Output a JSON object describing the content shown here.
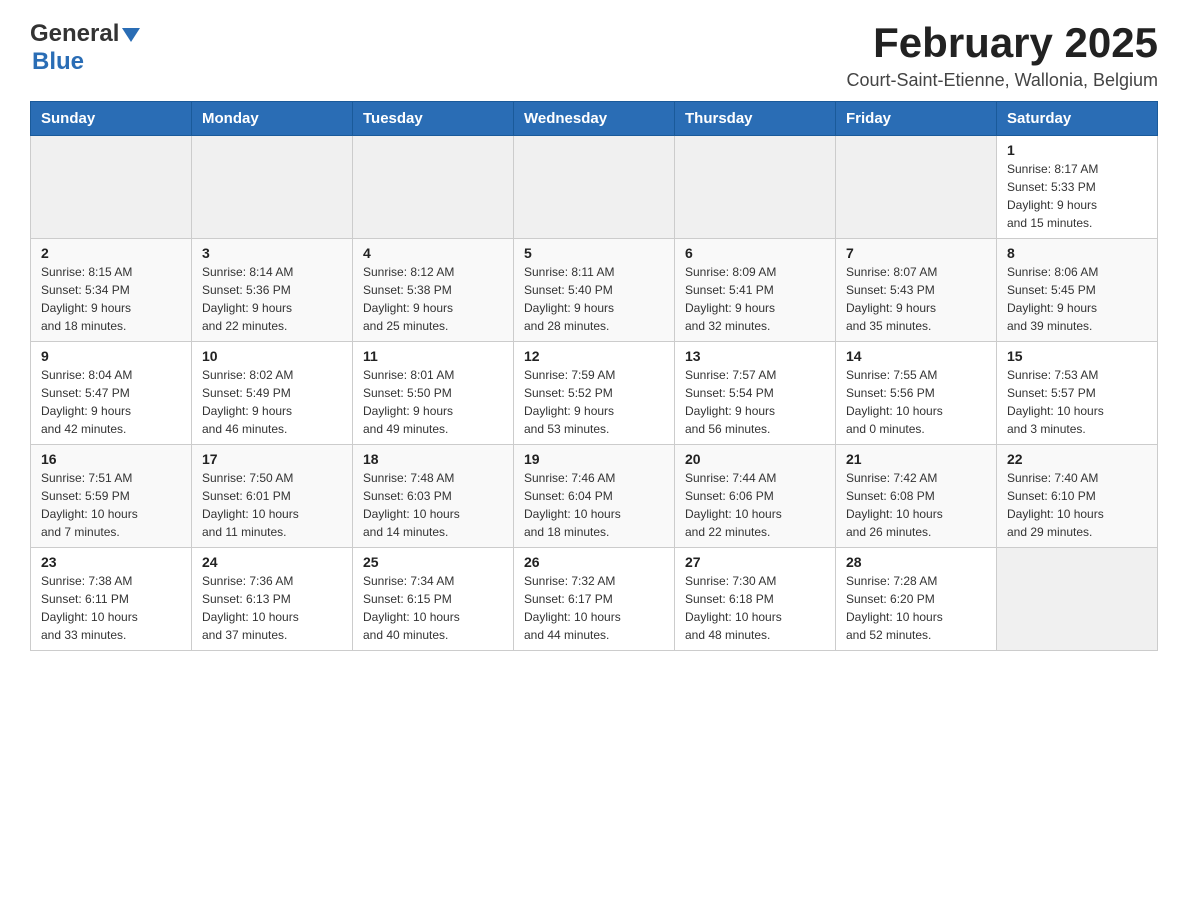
{
  "header": {
    "logo": {
      "general": "General",
      "blue": "Blue"
    },
    "title": "February 2025",
    "location": "Court-Saint-Etienne, Wallonia, Belgium"
  },
  "days_of_week": [
    "Sunday",
    "Monday",
    "Tuesday",
    "Wednesday",
    "Thursday",
    "Friday",
    "Saturday"
  ],
  "weeks": [
    [
      {
        "day": "",
        "info": ""
      },
      {
        "day": "",
        "info": ""
      },
      {
        "day": "",
        "info": ""
      },
      {
        "day": "",
        "info": ""
      },
      {
        "day": "",
        "info": ""
      },
      {
        "day": "",
        "info": ""
      },
      {
        "day": "1",
        "info": "Sunrise: 8:17 AM\nSunset: 5:33 PM\nDaylight: 9 hours\nand 15 minutes."
      }
    ],
    [
      {
        "day": "2",
        "info": "Sunrise: 8:15 AM\nSunset: 5:34 PM\nDaylight: 9 hours\nand 18 minutes."
      },
      {
        "day": "3",
        "info": "Sunrise: 8:14 AM\nSunset: 5:36 PM\nDaylight: 9 hours\nand 22 minutes."
      },
      {
        "day": "4",
        "info": "Sunrise: 8:12 AM\nSunset: 5:38 PM\nDaylight: 9 hours\nand 25 minutes."
      },
      {
        "day": "5",
        "info": "Sunrise: 8:11 AM\nSunset: 5:40 PM\nDaylight: 9 hours\nand 28 minutes."
      },
      {
        "day": "6",
        "info": "Sunrise: 8:09 AM\nSunset: 5:41 PM\nDaylight: 9 hours\nand 32 minutes."
      },
      {
        "day": "7",
        "info": "Sunrise: 8:07 AM\nSunset: 5:43 PM\nDaylight: 9 hours\nand 35 minutes."
      },
      {
        "day": "8",
        "info": "Sunrise: 8:06 AM\nSunset: 5:45 PM\nDaylight: 9 hours\nand 39 minutes."
      }
    ],
    [
      {
        "day": "9",
        "info": "Sunrise: 8:04 AM\nSunset: 5:47 PM\nDaylight: 9 hours\nand 42 minutes."
      },
      {
        "day": "10",
        "info": "Sunrise: 8:02 AM\nSunset: 5:49 PM\nDaylight: 9 hours\nand 46 minutes."
      },
      {
        "day": "11",
        "info": "Sunrise: 8:01 AM\nSunset: 5:50 PM\nDaylight: 9 hours\nand 49 minutes."
      },
      {
        "day": "12",
        "info": "Sunrise: 7:59 AM\nSunset: 5:52 PM\nDaylight: 9 hours\nand 53 minutes."
      },
      {
        "day": "13",
        "info": "Sunrise: 7:57 AM\nSunset: 5:54 PM\nDaylight: 9 hours\nand 56 minutes."
      },
      {
        "day": "14",
        "info": "Sunrise: 7:55 AM\nSunset: 5:56 PM\nDaylight: 10 hours\nand 0 minutes."
      },
      {
        "day": "15",
        "info": "Sunrise: 7:53 AM\nSunset: 5:57 PM\nDaylight: 10 hours\nand 3 minutes."
      }
    ],
    [
      {
        "day": "16",
        "info": "Sunrise: 7:51 AM\nSunset: 5:59 PM\nDaylight: 10 hours\nand 7 minutes."
      },
      {
        "day": "17",
        "info": "Sunrise: 7:50 AM\nSunset: 6:01 PM\nDaylight: 10 hours\nand 11 minutes."
      },
      {
        "day": "18",
        "info": "Sunrise: 7:48 AM\nSunset: 6:03 PM\nDaylight: 10 hours\nand 14 minutes."
      },
      {
        "day": "19",
        "info": "Sunrise: 7:46 AM\nSunset: 6:04 PM\nDaylight: 10 hours\nand 18 minutes."
      },
      {
        "day": "20",
        "info": "Sunrise: 7:44 AM\nSunset: 6:06 PM\nDaylight: 10 hours\nand 22 minutes."
      },
      {
        "day": "21",
        "info": "Sunrise: 7:42 AM\nSunset: 6:08 PM\nDaylight: 10 hours\nand 26 minutes."
      },
      {
        "day": "22",
        "info": "Sunrise: 7:40 AM\nSunset: 6:10 PM\nDaylight: 10 hours\nand 29 minutes."
      }
    ],
    [
      {
        "day": "23",
        "info": "Sunrise: 7:38 AM\nSunset: 6:11 PM\nDaylight: 10 hours\nand 33 minutes."
      },
      {
        "day": "24",
        "info": "Sunrise: 7:36 AM\nSunset: 6:13 PM\nDaylight: 10 hours\nand 37 minutes."
      },
      {
        "day": "25",
        "info": "Sunrise: 7:34 AM\nSunset: 6:15 PM\nDaylight: 10 hours\nand 40 minutes."
      },
      {
        "day": "26",
        "info": "Sunrise: 7:32 AM\nSunset: 6:17 PM\nDaylight: 10 hours\nand 44 minutes."
      },
      {
        "day": "27",
        "info": "Sunrise: 7:30 AM\nSunset: 6:18 PM\nDaylight: 10 hours\nand 48 minutes."
      },
      {
        "day": "28",
        "info": "Sunrise: 7:28 AM\nSunset: 6:20 PM\nDaylight: 10 hours\nand 52 minutes."
      },
      {
        "day": "",
        "info": ""
      }
    ]
  ]
}
